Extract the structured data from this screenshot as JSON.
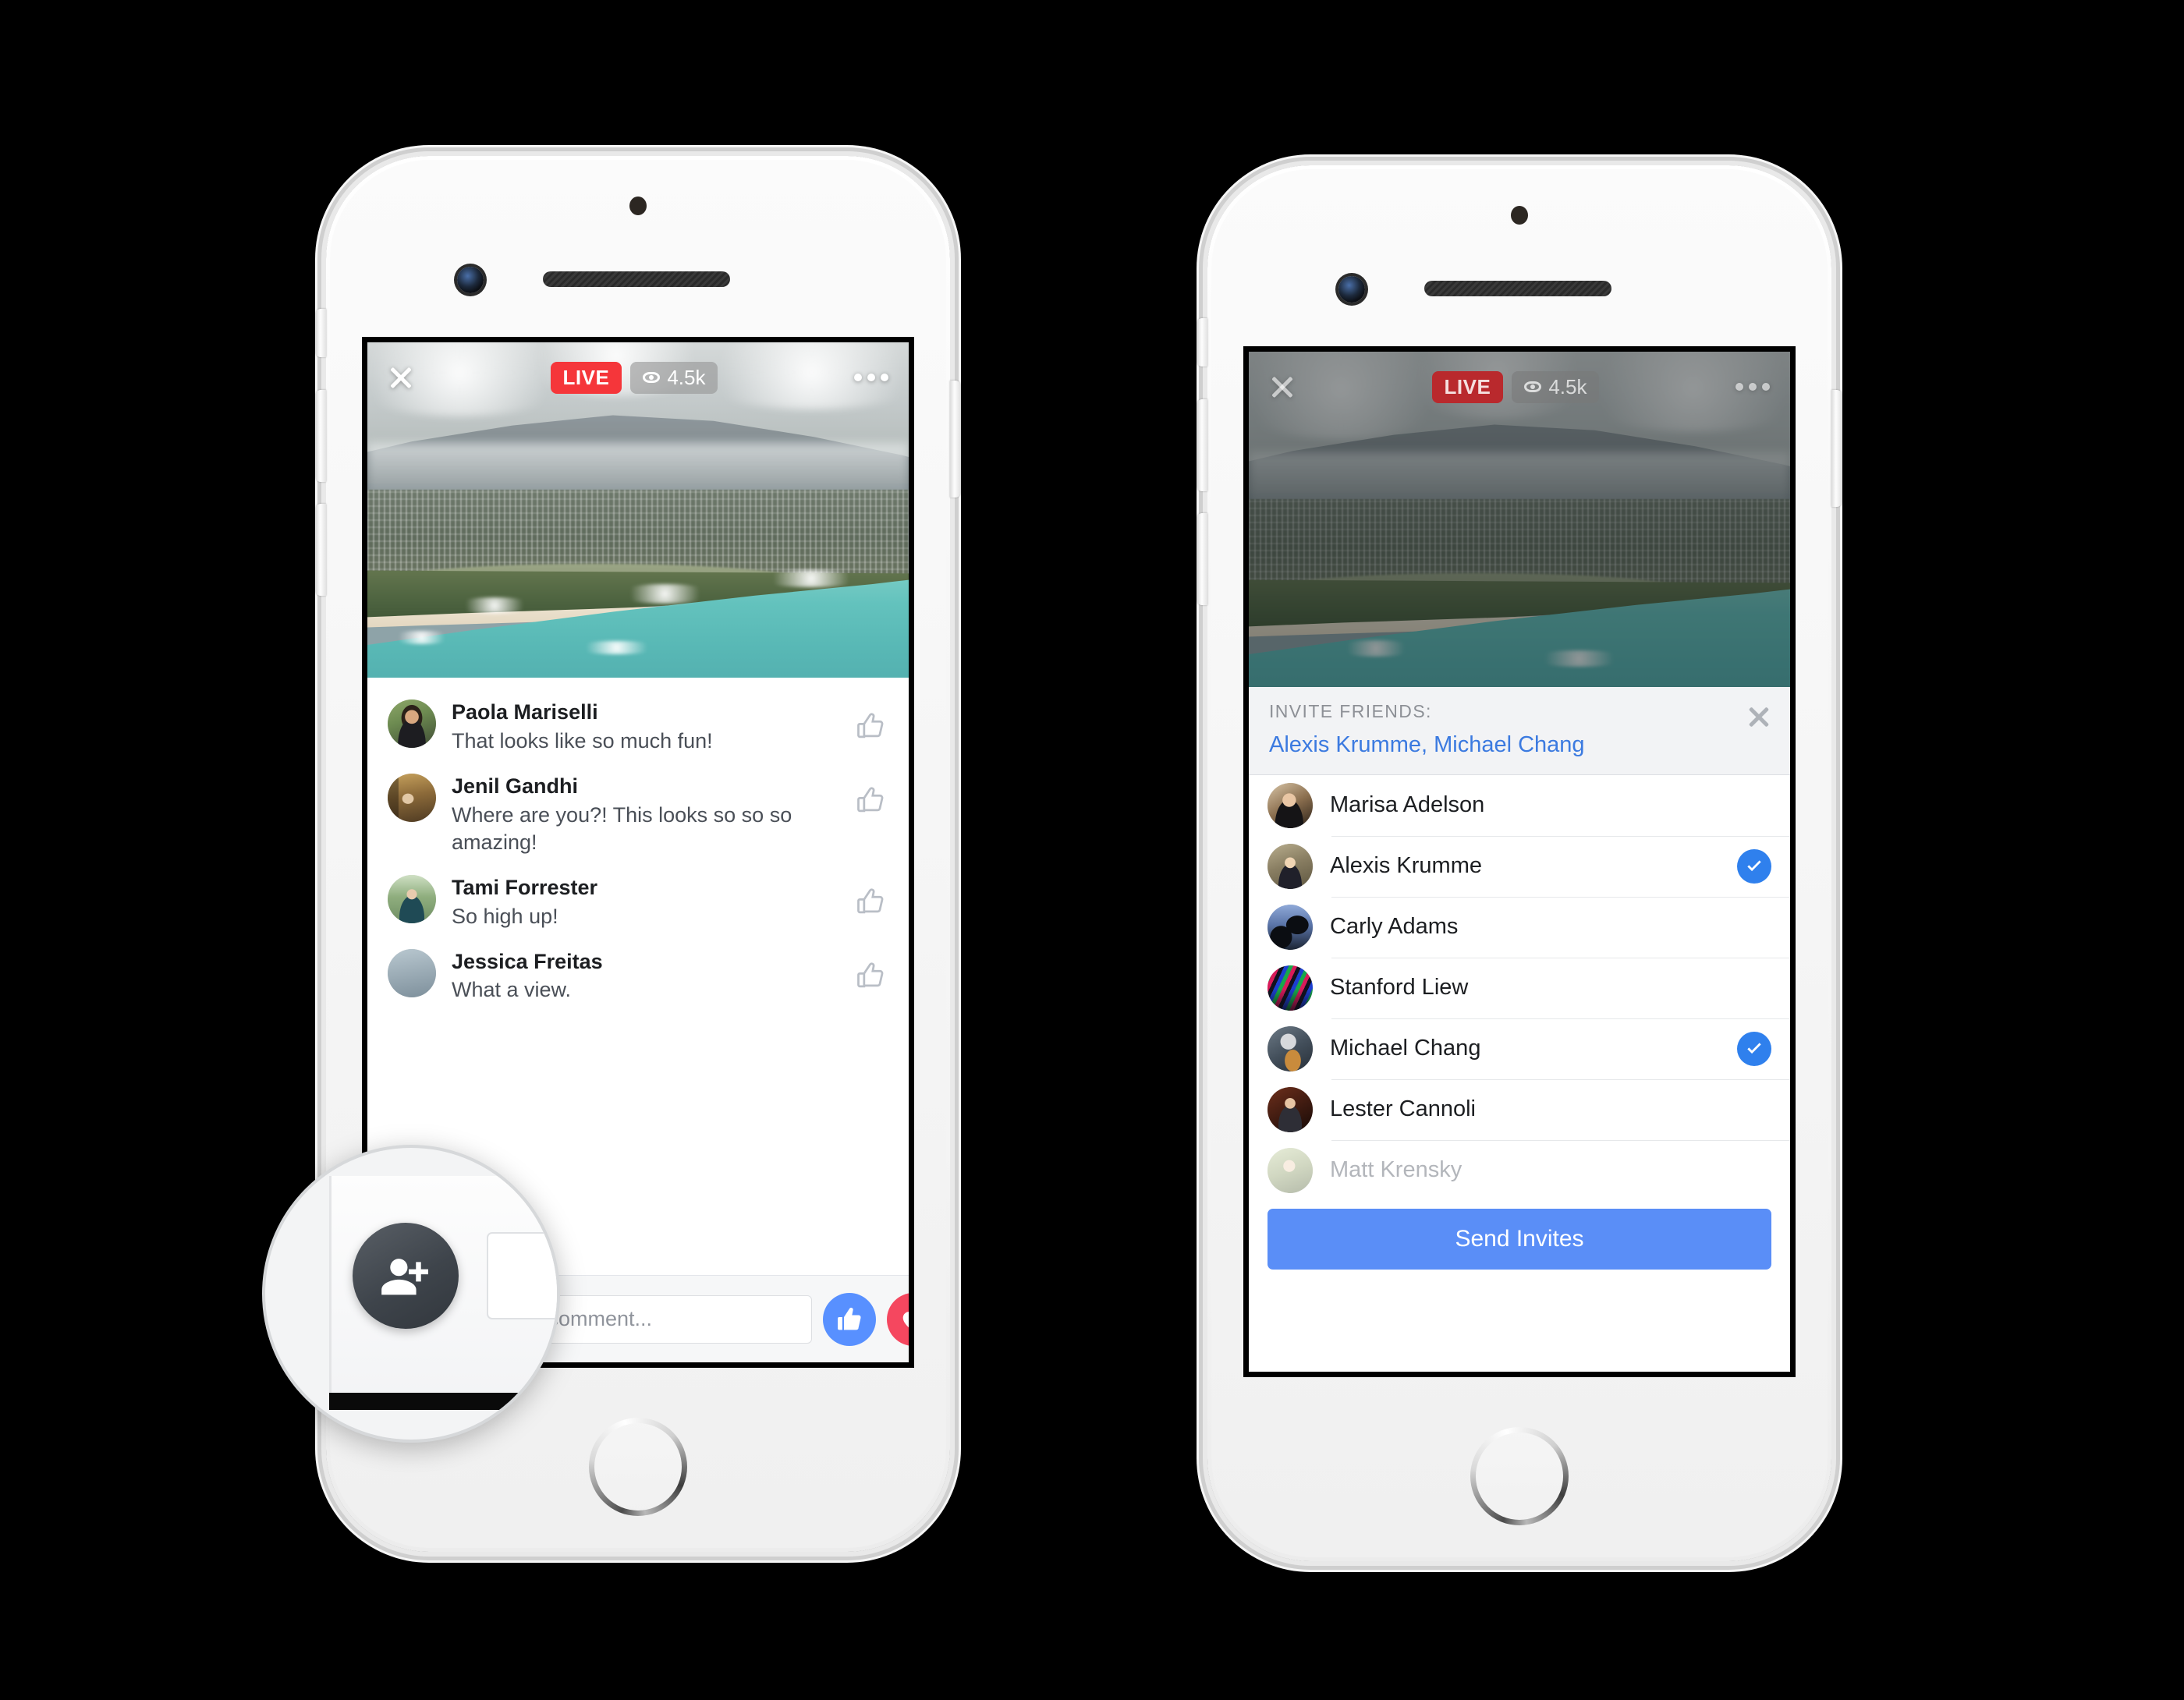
{
  "screens": {
    "left": {
      "video": {
        "live_label": "LIVE",
        "viewer_count": "4.5k",
        "close_icon": "close-icon",
        "more_icon": "more-options-icon",
        "eye_icon": "eye-icon"
      },
      "comments": [
        {
          "name": "Paola Mariselli",
          "text": "That looks like so much fun!"
        },
        {
          "name": "Jenil Gandhi",
          "text": "Where are you?! This looks so so so amazing!"
        },
        {
          "name": "Tami Forrester",
          "text": "So high up!"
        },
        {
          "name": "Jessica Freitas",
          "text": "What a view."
        }
      ],
      "composer": {
        "input_placeholder": "Write a comment...",
        "like_icon": "thumbs-up-icon",
        "love_icon": "heart-icon"
      }
    },
    "right": {
      "video": {
        "live_label": "LIVE",
        "viewer_count": "4.5k",
        "close_icon": "close-icon",
        "more_icon": "more-options-icon",
        "eye_icon": "eye-icon"
      },
      "invite": {
        "heading": "INVITE FRIENDS:",
        "selected_names": "Alexis Krumme, Michael Chang",
        "close_icon": "close-icon",
        "friends": [
          {
            "name": "Marisa Adelson",
            "selected": false
          },
          {
            "name": "Alexis Krumme",
            "selected": true
          },
          {
            "name": "Carly Adams",
            "selected": false
          },
          {
            "name": "Stanford Liew",
            "selected": false
          },
          {
            "name": "Michael Chang",
            "selected": true
          },
          {
            "name": "Lester Cannoli",
            "selected": false
          },
          {
            "name": "Matt Krensky",
            "selected": false
          }
        ],
        "send_button": "Send Invites"
      }
    }
  },
  "callout": {
    "icon": "add-person-icon",
    "description": "invite-friends-button-magnified"
  },
  "colors": {
    "live_red": "#f5363a",
    "facebook_blue": "#5890ff",
    "link_blue": "#3b7ae0",
    "check_blue": "#2f80ed",
    "send_blue": "#5a8ef7",
    "love_red": "#f5475f"
  }
}
